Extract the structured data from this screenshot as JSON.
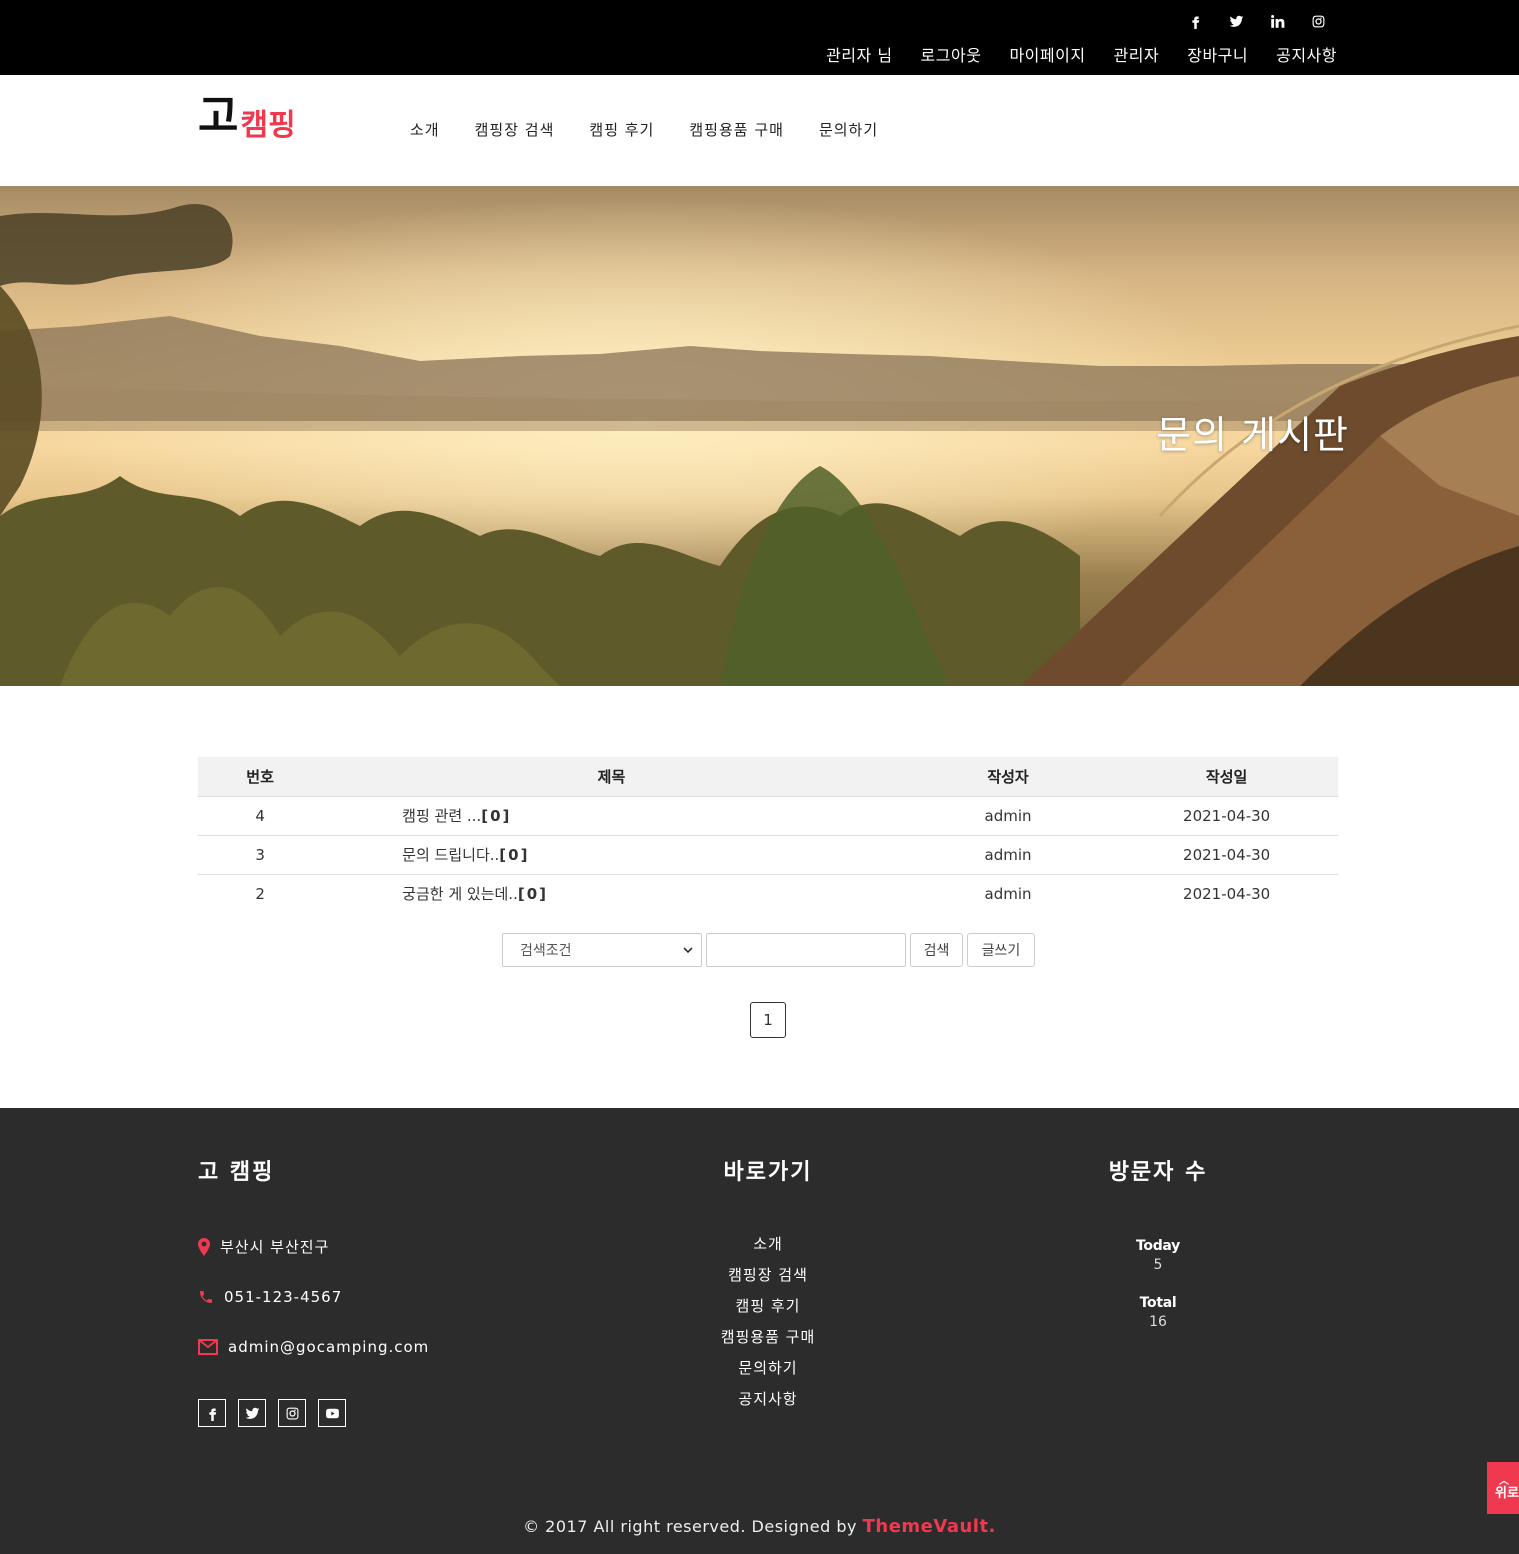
{
  "topbar": {
    "socials": [
      "facebook-icon",
      "twitter-icon",
      "linkedin-icon",
      "instagram-icon"
    ],
    "user_nav": [
      "관리자 님",
      "로그아웃",
      "마이페이지",
      "관리자",
      "장바구니",
      "공지사항"
    ]
  },
  "header": {
    "logo_main": "고",
    "logo_sub": "캠핑",
    "nav": [
      "소개",
      "캠핑장 검색",
      "캠핑 후기",
      "캠핑용품 구매",
      "문의하기"
    ]
  },
  "hero": {
    "title": "문의 게시판"
  },
  "board": {
    "columns": [
      "번호",
      "제목",
      "작성자",
      "작성일"
    ],
    "rows": [
      {
        "no": "4",
        "title": "캠핑 관련 ...",
        "comments": "[0]",
        "author": "admin",
        "date": "2021-04-30"
      },
      {
        "no": "3",
        "title": "문의 드립니다..",
        "comments": "[0]",
        "author": "admin",
        "date": "2021-04-30"
      },
      {
        "no": "2",
        "title": "궁금한 게 있는데..",
        "comments": "[0]",
        "author": "admin",
        "date": "2021-04-30"
      }
    ]
  },
  "search": {
    "select_value": "검색조건",
    "input_value": "",
    "search_button": "검색",
    "write_button": "글쓰기"
  },
  "pagination": {
    "current": "1"
  },
  "footer": {
    "brand_title": "고 캠핑",
    "address": "부산시 부산진구",
    "phone": "051-123-4567",
    "email": "admin@gocamping.com",
    "links_title": "바로가기",
    "links": [
      "소개",
      "캠핑장 검색",
      "캠핑 후기",
      "캠핑용품 구매",
      "문의하기",
      "공지사항"
    ],
    "visitors_title": "방문자 수",
    "today_label": "Today",
    "today_value": "5",
    "total_label": "Total",
    "total_value": "16",
    "socials": [
      "facebook-icon",
      "twitter-icon",
      "instagram-icon",
      "youtube-icon"
    ],
    "copyright": "© 2017 All right reserved. Designed by",
    "designer": "ThemeVault.",
    "to_top": "위로"
  },
  "colors": {
    "accent": "#f0394f",
    "topbar": "#000000",
    "footer": "#2c2c2c"
  }
}
